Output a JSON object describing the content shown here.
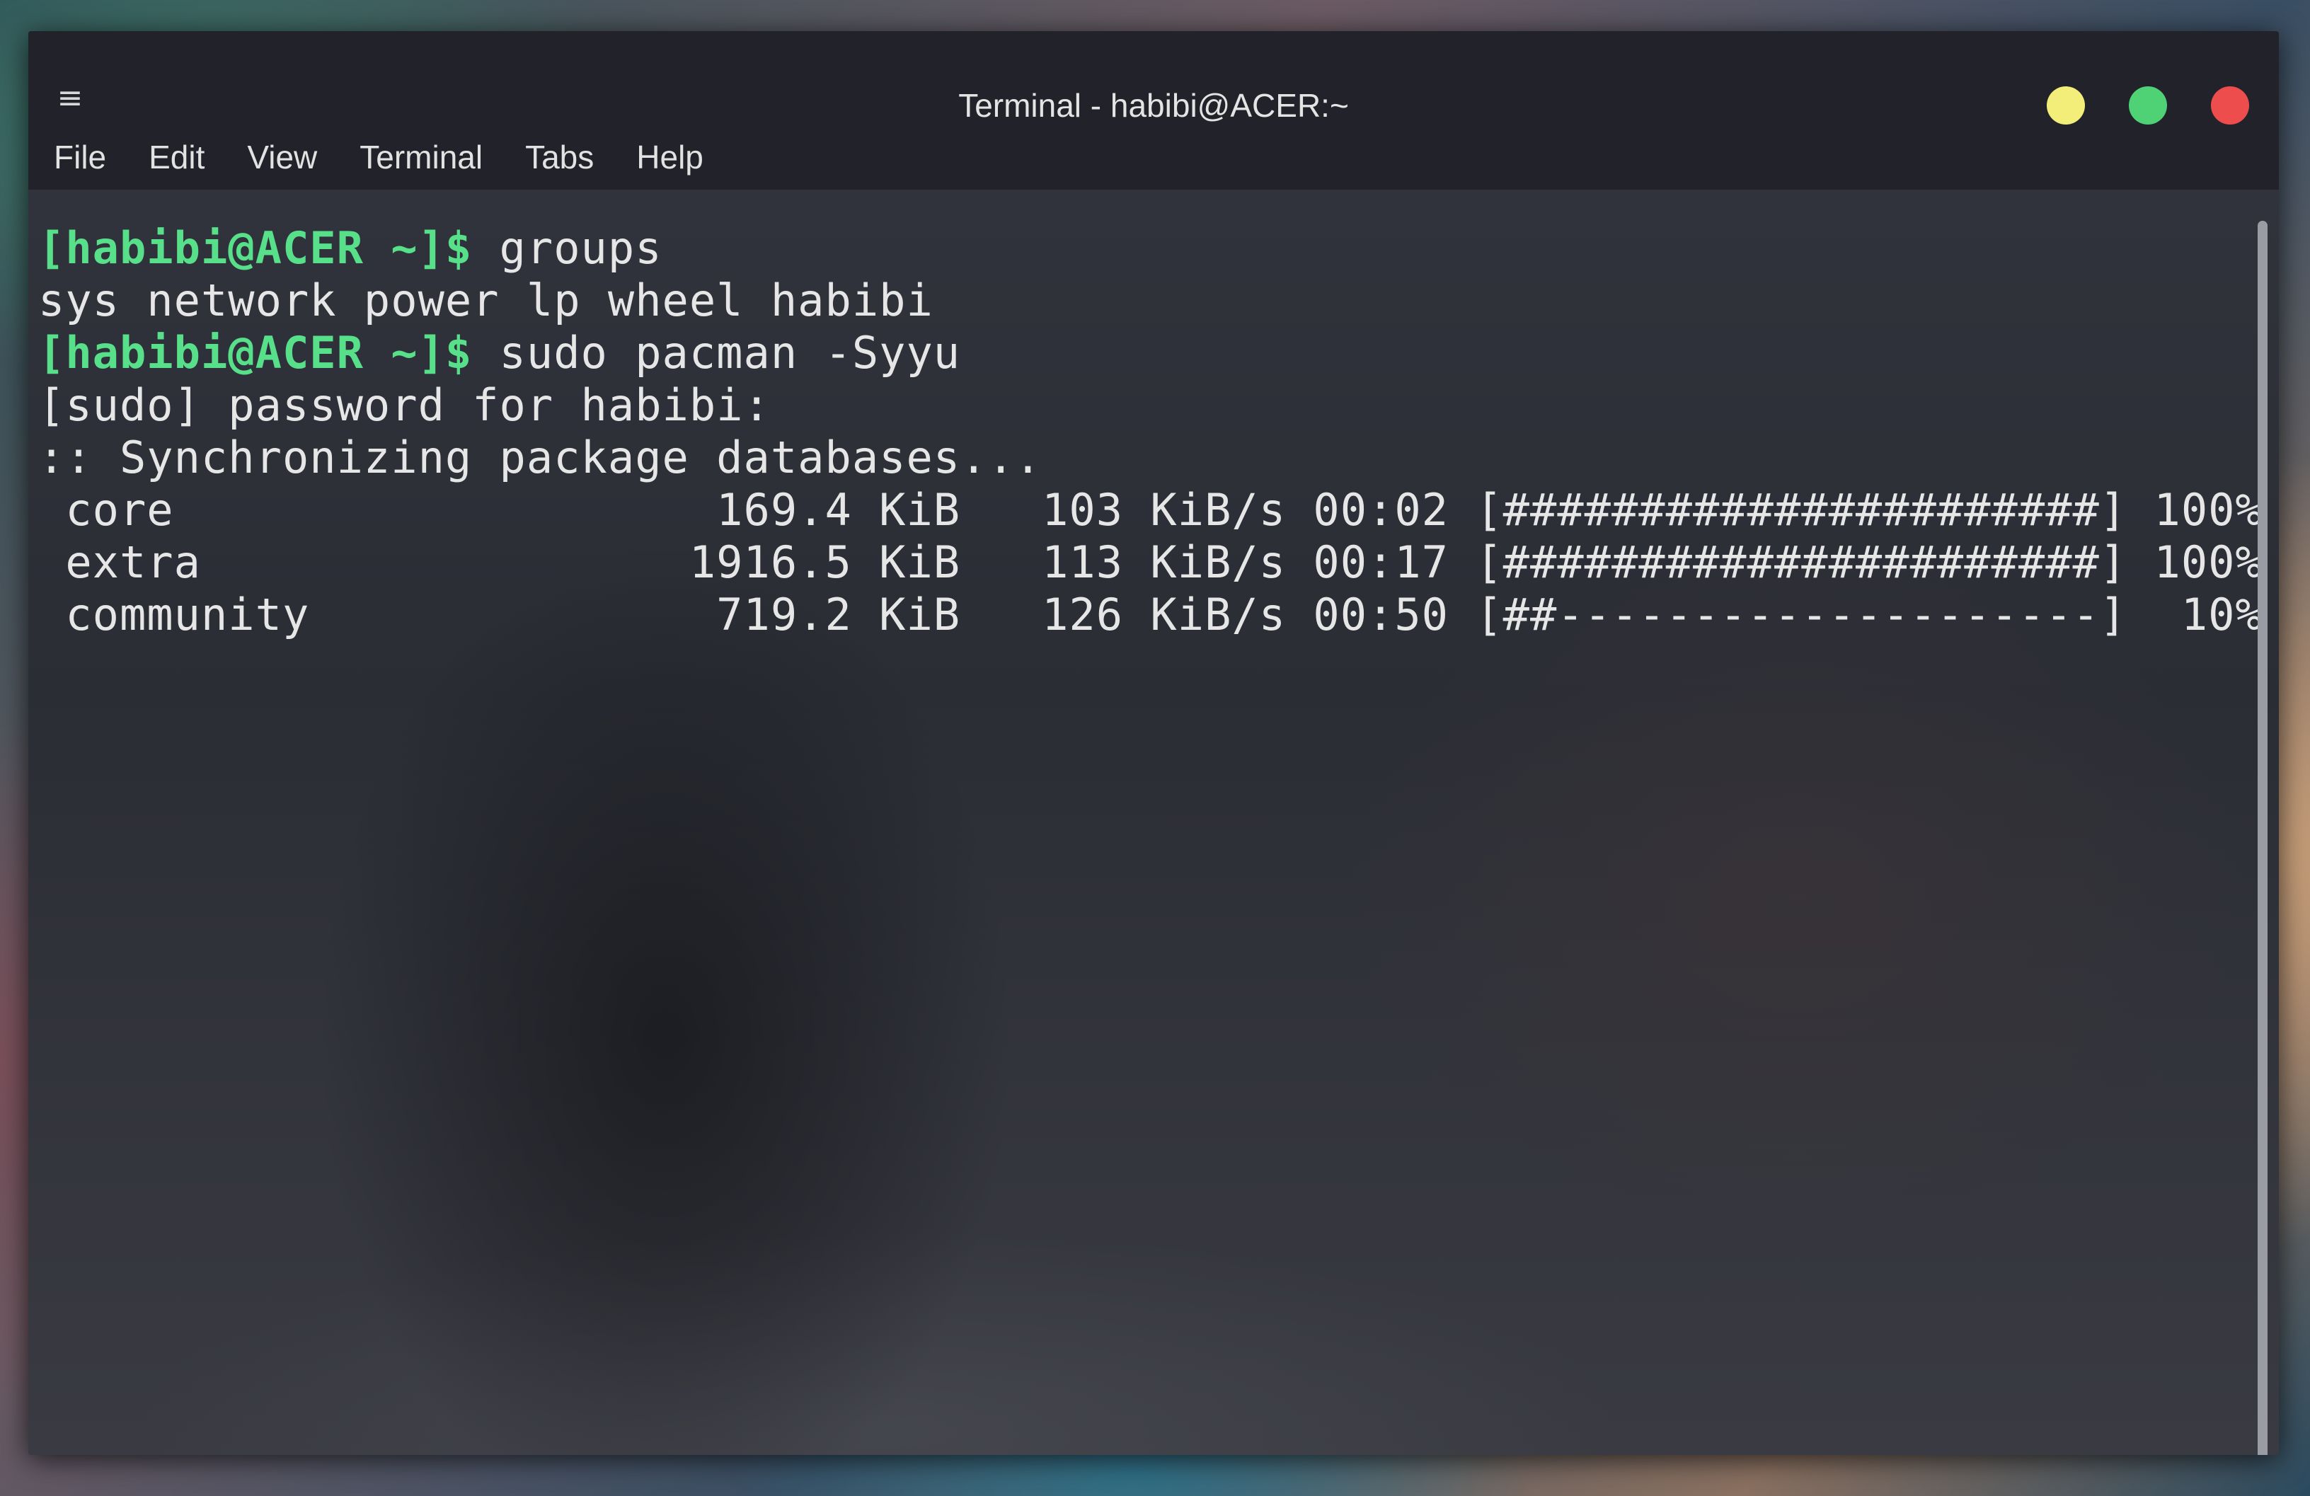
{
  "window": {
    "title": "Terminal - habibi@ACER:~",
    "menu_icon": "hamburger-menu-icon",
    "controls": {
      "minimize_color": "#f3ee7a",
      "maximize_color": "#4fd176",
      "close_color": "#ee4d4d"
    }
  },
  "menubar": {
    "items": [
      "File",
      "Edit",
      "View",
      "Terminal",
      "Tabs",
      "Help"
    ]
  },
  "terminal": {
    "prompt_color": "#57df8a",
    "lines": [
      {
        "prompt": "[habibi@ACER ~]$",
        "text": " groups"
      },
      {
        "prompt": "",
        "text": "sys network power lp wheel habibi"
      },
      {
        "prompt": "[habibi@ACER ~]$",
        "text": " sudo pacman -Syyu"
      },
      {
        "prompt": "",
        "text": "[sudo] password for habibi:"
      },
      {
        "prompt": "",
        "text": ":: Synchronizing package databases..."
      },
      {
        "prompt": "",
        "text": " core                    169.4 KiB   103 KiB/s 00:02 [######################] 100%"
      },
      {
        "prompt": "",
        "text": " extra                  1916.5 KiB   113 KiB/s 00:17 [######################] 100%"
      },
      {
        "prompt": "",
        "text": " community               719.2 KiB   126 KiB/s 00:50 [##--------------------]  10%"
      }
    ]
  }
}
